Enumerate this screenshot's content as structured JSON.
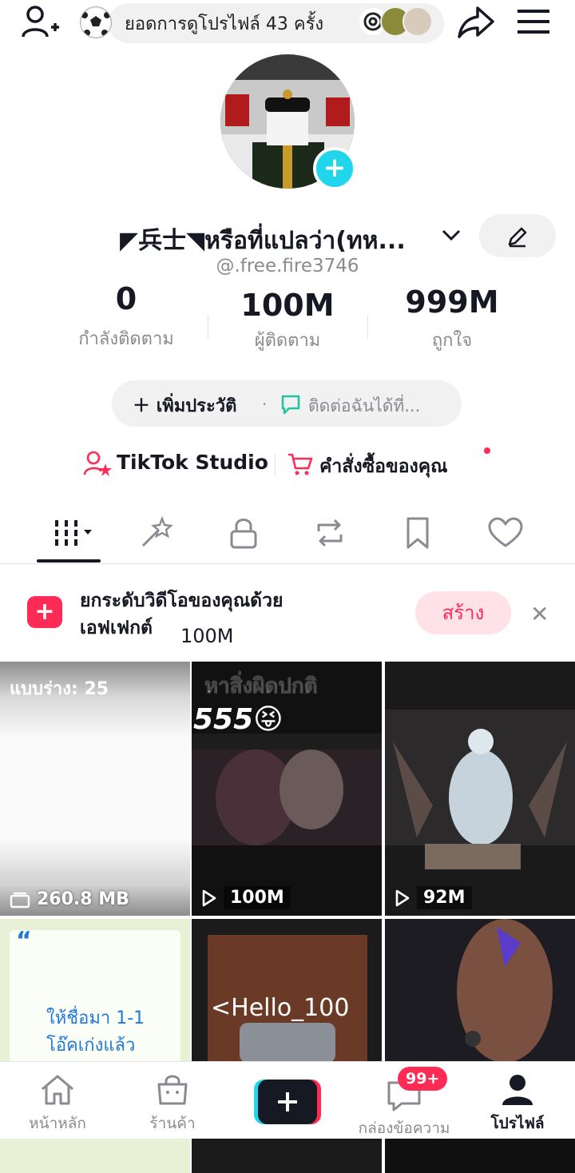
{
  "top_bar": {
    "profile_views_text": "ยอดการดูโปรไฟล์ 43 ครั้ง"
  },
  "profile": {
    "display_name": "◤兵士◥หรือที่แปลว่า(ทห...",
    "username": "@.free.fire3746",
    "stats": [
      {
        "value": "0",
        "label": "กำลังติดตาม"
      },
      {
        "value": "100M",
        "label": "ผู้ติดตาม"
      },
      {
        "value": "999M",
        "label": "ถูกใจ"
      }
    ],
    "add_bio_label": "เพิ่มประวัติ",
    "contact_label": "ติดต่อฉันได้ที่..."
  },
  "tools": {
    "studio_label": "TikTok Studio",
    "orders_label": "คำสั่งซื้อของคุณ"
  },
  "banner": {
    "line1": "ยกระดับวิดีโอของคุณด้วย",
    "line2": "เอฟเฟกต์",
    "overlay_text": "100M",
    "create_label": "สร้าง"
  },
  "videos": [
    {
      "kind": "drafts",
      "title": "แบบร่าง: 25",
      "count": "260.8 MB"
    },
    {
      "kind": "video",
      "caption": "หาสิ่งผิดปกติ",
      "caption2": "555😝",
      "count": "100M"
    },
    {
      "kind": "video",
      "count": "92M"
    },
    {
      "kind": "video",
      "caption": "ให้ชื่อมา 1-1",
      "caption2": "โอ๊คเก่งแล้ว"
    },
    {
      "kind": "video",
      "caption": "<Hello_100"
    },
    {
      "kind": "video"
    }
  ],
  "bottom_nav": {
    "home": "หน้าหลัก",
    "shop": "ร้านค้า",
    "inbox": "กล่องข้อความ",
    "inbox_badge": "99+",
    "profile": "โปรไฟล์"
  },
  "colors": {
    "accent": "#fe2c55",
    "cyan": "#20d5ec",
    "text": "#161823",
    "muted": "#8a8b91"
  }
}
